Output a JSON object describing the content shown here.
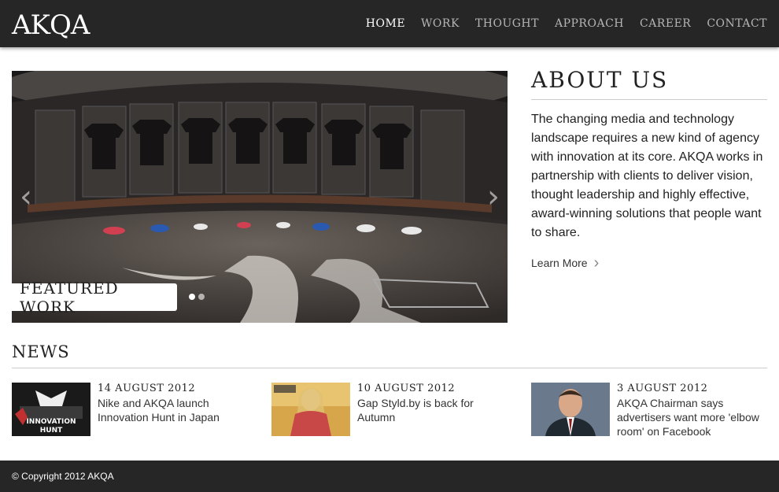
{
  "header": {
    "logo": "AKQA",
    "nav": [
      "HOME",
      "WORK",
      "THOUGHT",
      "APPROACH",
      "CAREER",
      "CONTACT"
    ],
    "active": "HOME"
  },
  "slider": {
    "label": "FEATURED WORK",
    "slides": 2,
    "current": 1,
    "prev_glyph": "‹",
    "next_glyph": "›"
  },
  "about": {
    "title": "ABOUT US",
    "body": "The changing media and technology landscape requires a new kind of agency with innovation at its core. AKQA works in partnership with clients to deliver vision, thought leadership and highly effective, award-winning solutions that people want to share.",
    "link": "Learn More"
  },
  "news": {
    "title": "NEWS",
    "items": [
      {
        "date": "14 AUGUST 2012",
        "headline": "Nike and AKQA launch Innovation Hunt in Japan"
      },
      {
        "date": "10 AUGUST 2012",
        "headline": "Gap Styld.by is back for Autumn"
      },
      {
        "date": "3 AUGUST 2012",
        "headline": "AKQA Chairman says advertisers want more 'elbow room' on Facebook"
      }
    ]
  },
  "footer": {
    "copyright": "© Copyright 2012 AKQA"
  },
  "colors": {
    "bar": "#262626",
    "text": "#222222",
    "rule": "#cccccc"
  }
}
